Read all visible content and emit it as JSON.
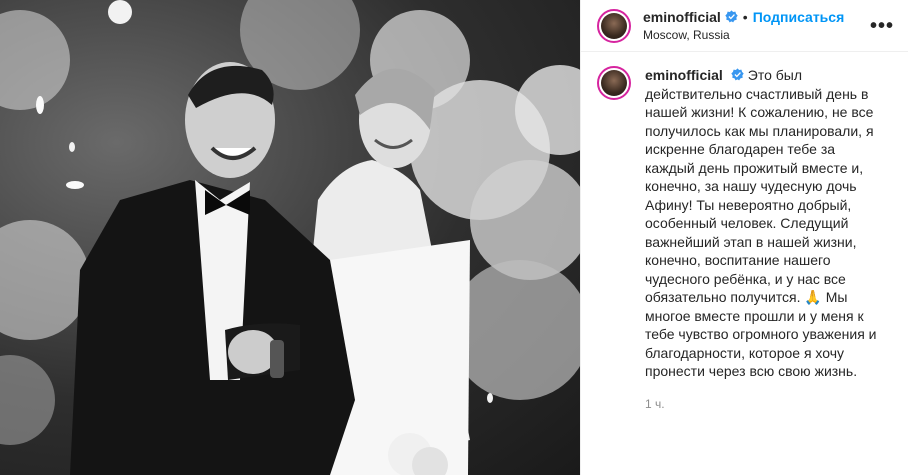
{
  "post": {
    "username": "eminofficial",
    "dot": "•",
    "follow_label": "Подписаться",
    "location": "Moscow, Russia",
    "more_label": "•••",
    "caption_username": "eminofficial",
    "caption_text": "Это был\nдействительно счастливый день в\nнашей жизни! К сожалению, не все\nполучилось как мы планировали, я\nискренне благодарен тебе за\nкаждый день прожитый вместе и,\nконечно, за нашу чудесную дочь\nАфину! Ты невероятно добрый,\nособенный человек. Следущий\nважнейший этап в нашей жизни,\nконечно, воспитание нашего\nчудесного ребёнка, и у нас все\nобязательно получится. 🙏 Мы\nмногое вместе прошли и у меня к\nтебе чувство огромного уважения и\nблагодарности, которое я хочу\nпронести через всю свою жизнь.",
    "time": "1 ч."
  },
  "icons": {
    "verified": "verified-badge-icon",
    "more": "more-options-icon"
  },
  "colors": {
    "follow": "#0095f6",
    "verified": "#3897f0",
    "story_ring": "#d6249f"
  }
}
